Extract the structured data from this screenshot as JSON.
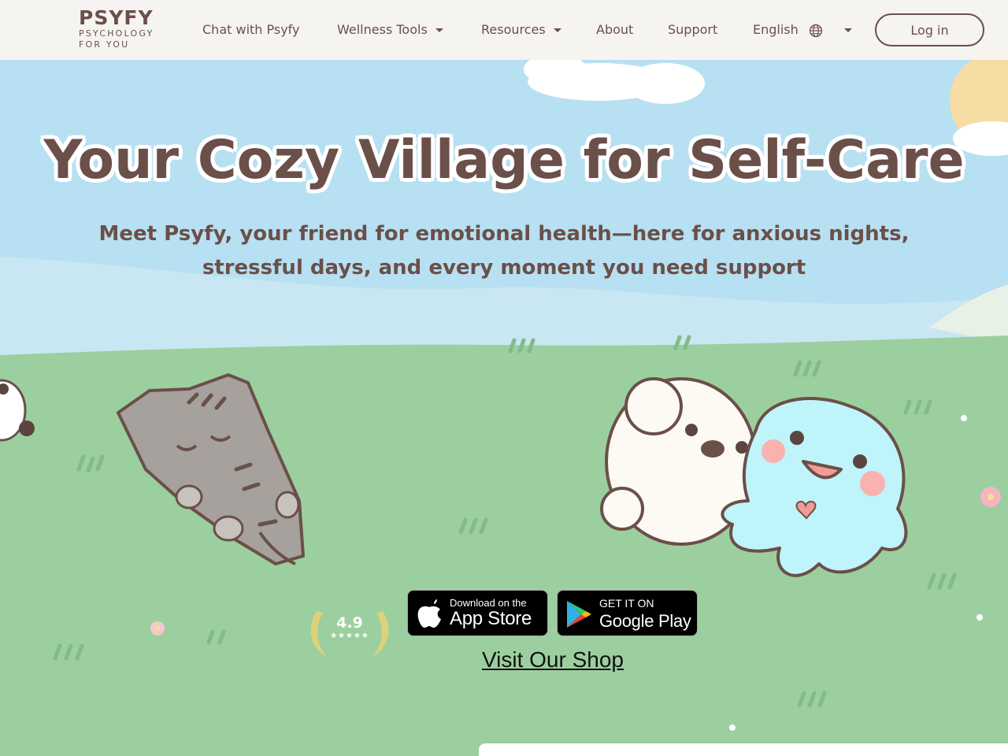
{
  "brand": {
    "name": "PSYFY",
    "tagline": "PSYCHOLOGY FOR YOU",
    "text_color": "#6b4f49"
  },
  "nav": {
    "items": [
      {
        "label": "Chat with Psyfy",
        "dropdown": false
      },
      {
        "label": "Wellness Tools",
        "dropdown": true
      },
      {
        "label": "Resources",
        "dropdown": true
      },
      {
        "label": "About",
        "dropdown": false
      },
      {
        "label": "Support",
        "dropdown": false
      }
    ],
    "language": {
      "label": "English",
      "icon": "globe-icon"
    },
    "login_label": "Log in"
  },
  "hero": {
    "headline": "Your Cozy Village for Self-Care",
    "subline_1": "Meet Psyfy, your friend for emotional health—here for anxious nights,",
    "subline_2": "stressful days, and every moment you need support",
    "rating": {
      "value": "4.9",
      "stars": "★★★★★"
    },
    "app_store": {
      "small": "Download on the",
      "big": "App Store",
      "icon": "apple-icon"
    },
    "google_play": {
      "small": "GET IT ON",
      "big": "Google Play",
      "icon": "google-play-icon"
    },
    "shop_link": "Visit Our Shop",
    "colors": {
      "sky": "#b7e0f2",
      "grass": "#9ccf9f",
      "text": "#6b4f49"
    }
  }
}
